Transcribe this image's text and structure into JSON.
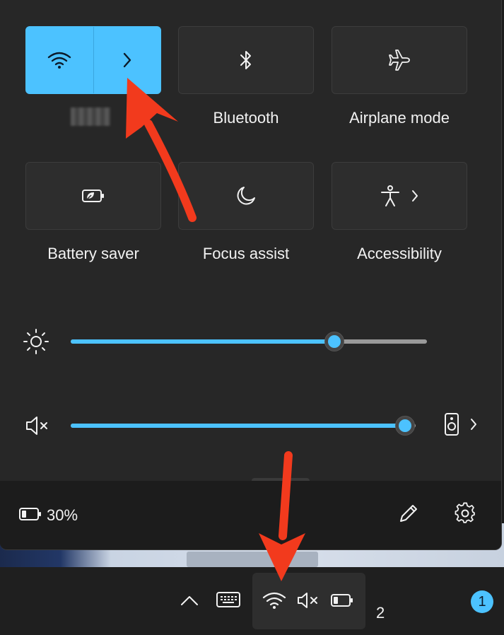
{
  "quick_settings": {
    "tiles": [
      {
        "id": "wifi",
        "label": "",
        "icon": "wifi-icon",
        "active": true
      },
      {
        "id": "bluetooth",
        "label": "Bluetooth",
        "icon": "bluetooth-icon",
        "active": false
      },
      {
        "id": "airplane",
        "label": "Airplane mode",
        "icon": "airplane-icon",
        "active": false
      },
      {
        "id": "battery_saver",
        "label": "Battery saver",
        "icon": "battery-saver-icon",
        "active": false
      },
      {
        "id": "focus_assist",
        "label": "Focus assist",
        "icon": "moon-icon",
        "active": false
      },
      {
        "id": "accessibility",
        "label": "Accessibility",
        "icon": "accessibility-icon",
        "active": false
      }
    ],
    "brightness": {
      "icon": "sun-icon",
      "value_percent": 74
    },
    "volume": {
      "icon": "speaker-muted-icon",
      "value_percent": 97,
      "output_icon": "speaker-device-icon"
    }
  },
  "footer": {
    "battery_text": "30%",
    "battery_icon": "battery-icon",
    "edit_icon": "pencil-icon",
    "settings_icon": "gear-icon"
  },
  "taskbar": {
    "icons": [
      "chevron-up-icon",
      "keyboard-icon",
      "wifi-icon",
      "speaker-muted-icon",
      "battery-icon"
    ],
    "clock_partial": "2",
    "notification_count": "1"
  },
  "colors": {
    "accent": "#4cc2ff",
    "annotation_arrow": "#f23a1d",
    "tile_bg": "#2d2d2d",
    "panel_bg": "#272727"
  }
}
